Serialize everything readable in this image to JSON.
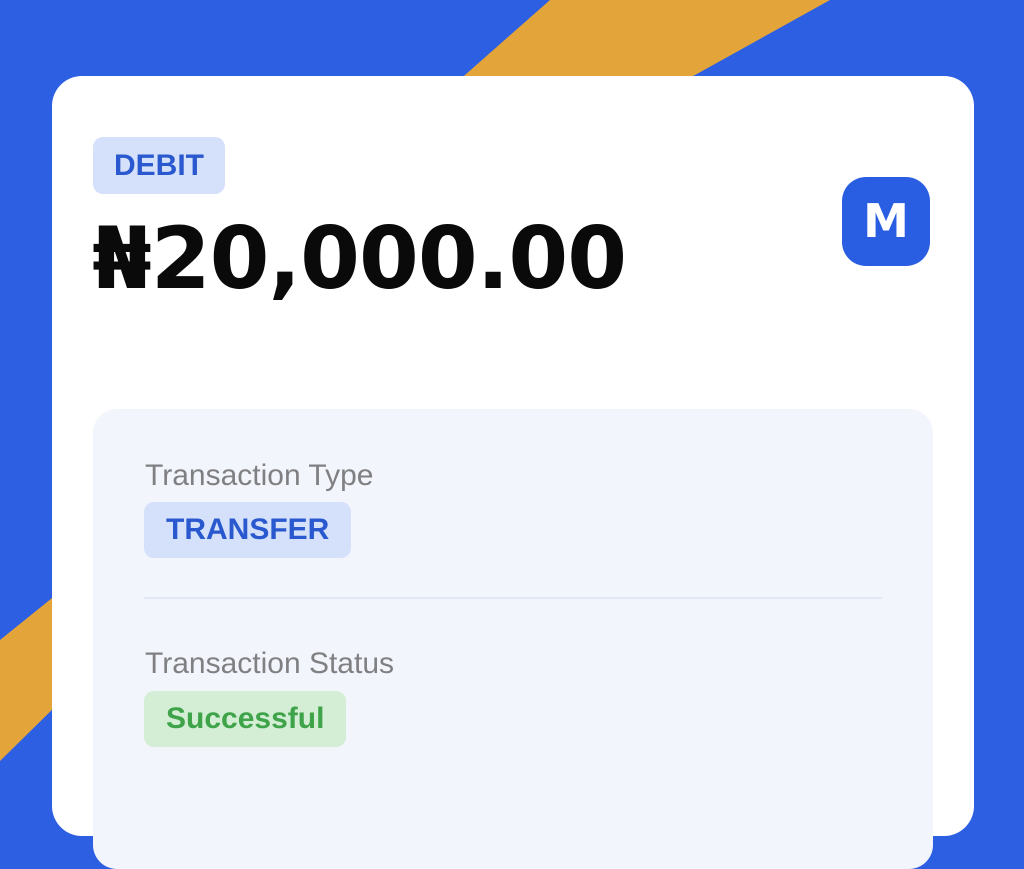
{
  "receipt": {
    "direction_badge": "DEBIT",
    "amount": "₦20,000.00",
    "logo_letter": "M"
  },
  "details": {
    "transaction_type": {
      "label": "Transaction Type",
      "value": "TRANSFER"
    },
    "transaction_status": {
      "label": "Transaction Status",
      "value": "Successful"
    }
  },
  "colors": {
    "background_blue": "#2d5fe3",
    "stripe_gold": "#e3a43a",
    "card_white": "#ffffff",
    "panel_tint": "#f2f5fc",
    "badge_blue_bg": "#d5e1fa",
    "badge_blue_text": "#2a59cf",
    "badge_green_bg": "#d3eed5",
    "badge_green_text": "#3ea349"
  }
}
